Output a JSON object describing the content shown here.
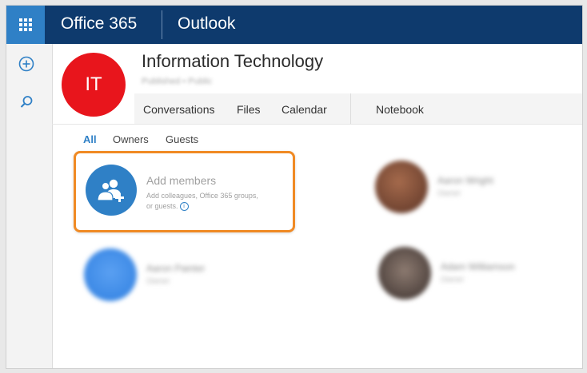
{
  "header": {
    "brand": "Office 365",
    "app": "Outlook",
    "waffle_icon": "app-launcher-icon"
  },
  "rail": {
    "items": [
      {
        "icon": "add-circle-icon"
      },
      {
        "icon": "search-icon"
      }
    ]
  },
  "group": {
    "initials": "IT",
    "name": "Information Technology",
    "subtitle": "Published • Public",
    "avatar_color": "#e8151c"
  },
  "nav": {
    "tabs": [
      "Conversations",
      "Files",
      "Calendar",
      "Notebook"
    ]
  },
  "filters": {
    "items": [
      "All",
      "Owners",
      "Guests"
    ],
    "active": "All"
  },
  "add_members": {
    "title": "Add members",
    "desc_line1": "Add colleagues, Office 365 groups,",
    "desc_line2": "or guests.",
    "highlight_color": "#f08a24"
  },
  "members": [
    {
      "name": "Aaron Wright",
      "sub": "Owner",
      "avatar": "#8b5a44"
    },
    {
      "name": "Aaron Painter",
      "sub": "Owner",
      "avatar": "#3b8eea"
    },
    {
      "name": "Adam Williamson",
      "sub": "Owner",
      "avatar": "#5a4b46"
    }
  ],
  "colors": {
    "topbar": "#0e3a6d",
    "accent": "#2f80c6"
  }
}
